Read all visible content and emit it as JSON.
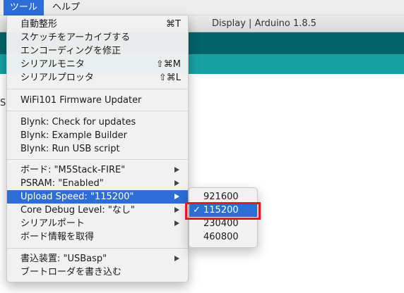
{
  "menubar": {
    "items": [
      {
        "label": "ツール"
      },
      {
        "label": "ヘルプ"
      }
    ]
  },
  "window": {
    "title": "Display | Arduino 1.8.5"
  },
  "editor": {
    "stub_text": "S"
  },
  "menu": {
    "items": [
      {
        "label": "自動整形",
        "shortcut": "⌘T"
      },
      {
        "label": "スケッチをアーカイブする"
      },
      {
        "label": "エンコーディングを修正"
      },
      {
        "label": "シリアルモニタ",
        "shortcut": "⇧⌘M"
      },
      {
        "label": "シリアルプロッタ",
        "shortcut": "⇧⌘L"
      },
      {
        "label": "WiFi101 Firmware Updater"
      },
      {
        "label": "Blynk: Check for updates"
      },
      {
        "label": "Blynk: Example Builder"
      },
      {
        "label": "Blynk: Run USB script"
      },
      {
        "label": "ボード: \"M5Stack-FIRE\""
      },
      {
        "label": "PSRAM: \"Enabled\""
      },
      {
        "label": "Upload Speed: \"115200\""
      },
      {
        "label": "Core Debug Level: \"なし\""
      },
      {
        "label": "シリアルポート"
      },
      {
        "label": "ボード情報を取得"
      },
      {
        "label": "書込装置: \"USBasp\""
      },
      {
        "label": "ブートローダを書き込む"
      }
    ]
  },
  "submenu": {
    "check": "✓",
    "options": [
      {
        "label": "921600"
      },
      {
        "label": "115200"
      },
      {
        "label": "230400"
      },
      {
        "label": "460800"
      }
    ]
  },
  "colors": {
    "highlight": "#2c6ed6",
    "toolbar_dark": "#006468",
    "toolbar_teal": "#17a1a5",
    "annotation": "#e01b1b"
  }
}
